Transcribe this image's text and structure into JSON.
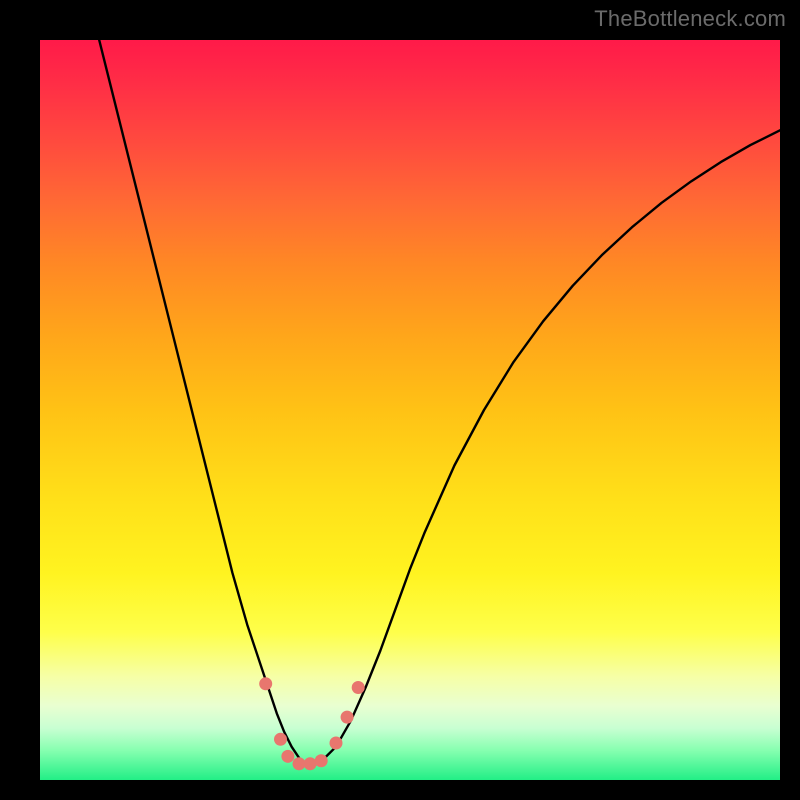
{
  "watermark": "TheBottleneck.com",
  "chart_data": {
    "type": "line",
    "title": "",
    "xlabel": "",
    "ylabel": "",
    "xlim": [
      0,
      100
    ],
    "ylim": [
      0,
      100
    ],
    "grid": false,
    "legend": false,
    "series": [
      {
        "name": "curve",
        "color": "#000000",
        "x": [
          8,
          10,
          12,
          14,
          16,
          18,
          20,
          22,
          24,
          26,
          28,
          30,
          32,
          33,
          34,
          35,
          36,
          37,
          38,
          40,
          42,
          44,
          46,
          48,
          50,
          52,
          56,
          60,
          64,
          68,
          72,
          76,
          80,
          84,
          88,
          92,
          96,
          100
        ],
        "y": [
          100,
          92,
          84,
          76,
          68,
          60,
          52,
          44,
          36,
          28,
          21,
          15,
          9,
          6.5,
          4.5,
          3,
          2,
          2,
          2.5,
          4.5,
          8,
          12.5,
          17.5,
          23,
          28.5,
          33.5,
          42.5,
          50,
          56.5,
          62,
          66.8,
          71,
          74.7,
          78,
          80.9,
          83.5,
          85.8,
          87.8
        ]
      }
    ],
    "markers": [
      {
        "x": 30.5,
        "y": 13,
        "r": 6.5,
        "color": "#e8766e"
      },
      {
        "x": 32.5,
        "y": 5.5,
        "r": 6.5,
        "color": "#e8766e"
      },
      {
        "x": 33.5,
        "y": 3.2,
        "r": 6.5,
        "color": "#e8766e"
      },
      {
        "x": 35.0,
        "y": 2.2,
        "r": 6.5,
        "color": "#e8766e"
      },
      {
        "x": 36.5,
        "y": 2.2,
        "r": 6.5,
        "color": "#e8766e"
      },
      {
        "x": 38.0,
        "y": 2.6,
        "r": 6.5,
        "color": "#e8766e"
      },
      {
        "x": 40.0,
        "y": 5.0,
        "r": 6.5,
        "color": "#e8766e"
      },
      {
        "x": 41.5,
        "y": 8.5,
        "r": 6.5,
        "color": "#e8766e"
      },
      {
        "x": 43.0,
        "y": 12.5,
        "r": 6.5,
        "color": "#e8766e"
      }
    ],
    "gradient_colors": {
      "top": "#ff1a49",
      "mid_upper": "#ff8725",
      "mid": "#ffe019",
      "mid_lower": "#feff4a",
      "bottom": "#22ef86"
    }
  }
}
